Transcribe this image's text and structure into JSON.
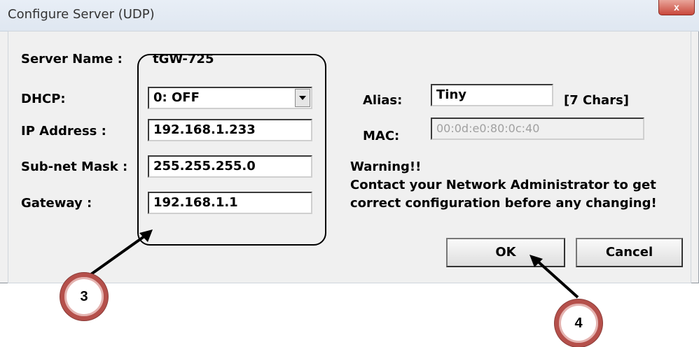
{
  "window": {
    "title": "Configure Server (UDP)",
    "close_glyph": "x"
  },
  "server_name": {
    "label": "Server Name :",
    "value": "tGW-725"
  },
  "dhcp": {
    "label": "DHCP:",
    "value": "0: OFF"
  },
  "ip": {
    "label": "IP Address :",
    "value": "192.168.1.233"
  },
  "mask": {
    "label": "Sub-net Mask :",
    "value": "255.255.255.0"
  },
  "gateway": {
    "label": "Gateway :",
    "value": "192.168.1.1"
  },
  "alias": {
    "label": "Alias:",
    "value": "Tiny",
    "hint": "[7 Chars]"
  },
  "mac": {
    "label": "MAC:",
    "value": "00:0d:e0:80:0c:40"
  },
  "warning": {
    "title": "Warning!!",
    "line1": "Contact your Network Administrator to get",
    "line2": "correct  configuration before any changing!"
  },
  "buttons": {
    "ok": "OK",
    "cancel": "Cancel"
  },
  "callouts": {
    "step3": "3",
    "step4": "4"
  },
  "colors": {
    "callout_ring": "#b5504b",
    "close_button": "#c9483b"
  }
}
